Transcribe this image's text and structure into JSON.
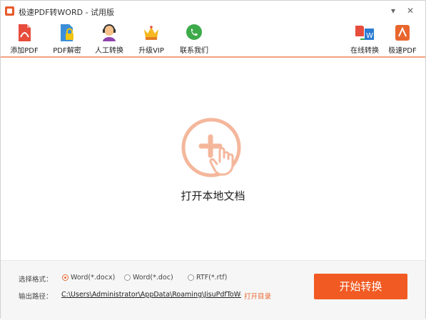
{
  "window": {
    "title": "极速PDF转WORD - 试用版",
    "min_glyph": "▾",
    "close_glyph": "✕"
  },
  "toolbar": {
    "add_pdf": "添加PDF",
    "pdf_decrypt": "PDF解密",
    "manual_convert": "人工转换",
    "upgrade_vip": "升级VIP",
    "contact_us": "联系我们",
    "online_convert": "在线转换",
    "jisu_pdf": "极速PDF"
  },
  "main": {
    "open_label": "打开本地文档"
  },
  "output": {
    "format_label": "选择格式：",
    "formats": [
      {
        "label": "Word(*.docx)",
        "selected": true
      },
      {
        "label": "Word(*.doc)",
        "selected": false
      },
      {
        "label": "RTF(*.rtf)",
        "selected": false
      }
    ],
    "path_label": "输出路径：",
    "path_value": "C:\\Users\\Administrator\\AppData\\Roaming\\JisuPdfToWc",
    "open_dir": "打开目录",
    "start_button": "开始转换"
  },
  "colors": {
    "accent": "#f15a22",
    "circle": "#f4b79c"
  }
}
